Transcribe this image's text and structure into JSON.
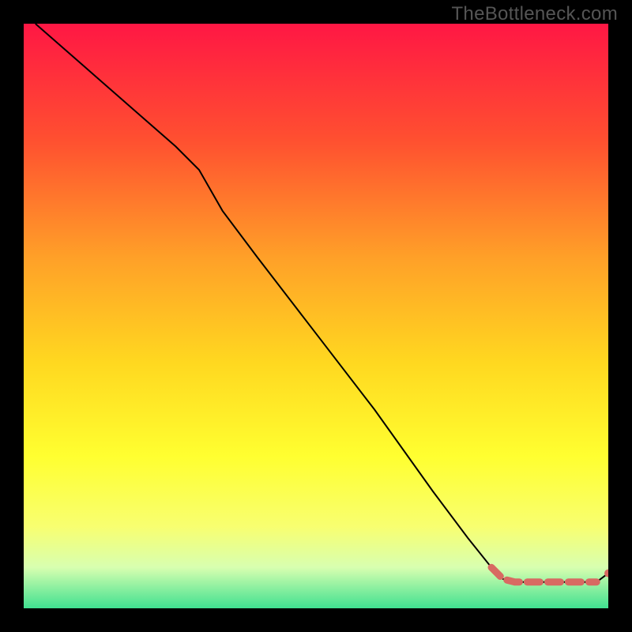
{
  "watermark": "TheBottleneck.com",
  "colors": {
    "gradient_top": "#ff1744",
    "gradient_upper_mid": "#ff5030",
    "gradient_mid1": "#ffa028",
    "gradient_mid2": "#ffd820",
    "gradient_mid3": "#ffff30",
    "gradient_low": "#f8ff70",
    "gradient_lower": "#d8ffb0",
    "gradient_bottom": "#40e090",
    "line": "#000000",
    "highlight": "#d86a62",
    "dot": "#d86a62"
  },
  "chart_data": {
    "type": "line",
    "xlim": [
      0,
      100
    ],
    "ylim": [
      0,
      100
    ],
    "line_series": {
      "name": "curve",
      "x": [
        2,
        10,
        18,
        26,
        30,
        34,
        40,
        50,
        60,
        70,
        76,
        80,
        82,
        84,
        86,
        88,
        90,
        92,
        94,
        96,
        98,
        100
      ],
      "y": [
        100,
        93,
        86,
        79,
        75,
        68,
        60,
        47,
        34,
        20,
        12,
        7,
        5.0,
        4.5,
        4.5,
        4.5,
        4.5,
        4.5,
        4.5,
        4.5,
        4.5,
        6.0
      ]
    },
    "highlight_segment": {
      "name": "bottleneck-zone",
      "x": [
        80,
        82,
        84,
        86,
        88,
        90,
        92,
        94,
        96,
        98
      ],
      "y": [
        7,
        5.0,
        4.5,
        4.5,
        4.5,
        4.5,
        4.5,
        4.5,
        4.5,
        4.5
      ]
    },
    "end_dot": {
      "x": 100,
      "y": 6.0
    }
  }
}
